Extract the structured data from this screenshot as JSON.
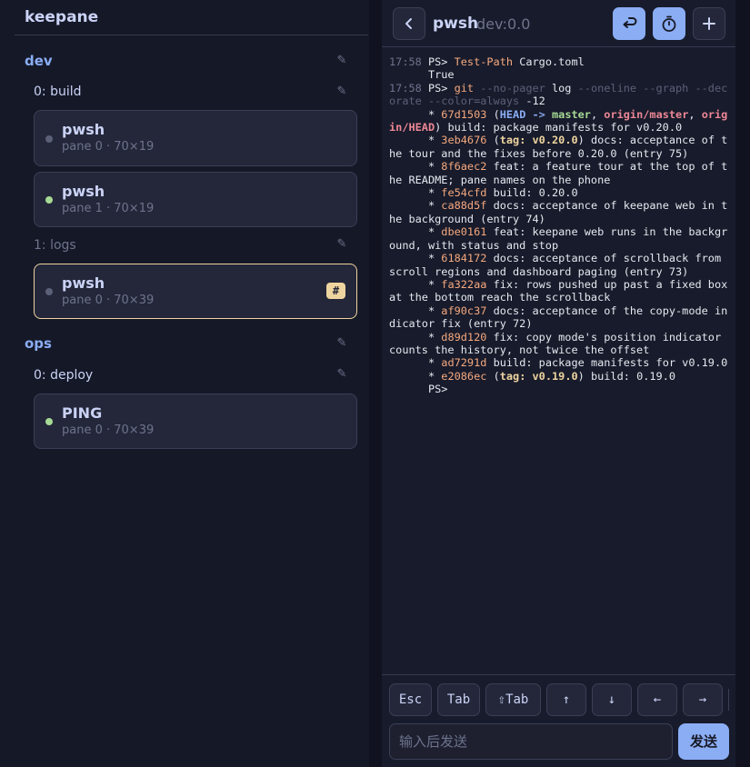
{
  "app": {
    "title": "keepane"
  },
  "sidebar": {
    "sessions": [
      {
        "name": "dev",
        "windows": [
          {
            "label": "0: build",
            "panes": [
              {
                "title": "pwsh",
                "meta": "pane 0 · 70×19",
                "status": "idle"
              },
              {
                "title": "pwsh",
                "meta": "pane 1 · 70×19",
                "status": "live"
              }
            ]
          },
          {
            "label": "1: logs",
            "panes": [
              {
                "title": "pwsh",
                "meta": "pane 0 · 70×39",
                "status": "idle",
                "badge": "#",
                "active": true
              }
            ]
          }
        ]
      },
      {
        "name": "ops",
        "windows": [
          {
            "label": "0: deploy",
            "panes": [
              {
                "title": "PING",
                "meta": "pane 0 · 70×39",
                "status": "live"
              }
            ]
          }
        ]
      }
    ]
  },
  "terminal": {
    "title": "pwsh",
    "target": "dev:0.0",
    "lines": [
      [
        [
          "17:58 ",
          "time"
        ],
        [
          "PS> ",
          ""
        ],
        [
          "Test-Path",
          "cmd"
        ],
        [
          " Cargo.toml",
          ""
        ]
      ],
      [
        [
          "      True",
          ""
        ]
      ],
      [
        [
          "17:58 ",
          "time"
        ],
        [
          "PS> ",
          ""
        ],
        [
          "git",
          "cmd"
        ],
        [
          " --no-pager",
          "flag"
        ],
        [
          " log",
          ""
        ],
        [
          " --oneline --graph --decorate --color=always",
          "flag"
        ],
        [
          " -12",
          ""
        ]
      ],
      [
        [
          "      * ",
          ""
        ],
        [
          "67d1503",
          "hash"
        ],
        [
          " (",
          ""
        ],
        [
          "HEAD -> ",
          "head"
        ],
        [
          "master",
          "branch"
        ],
        [
          ", ",
          ""
        ],
        [
          "origin/master",
          "remote"
        ],
        [
          ", ",
          ""
        ],
        [
          "origin/HEAD",
          "remote"
        ],
        [
          ") build: package manifests for v0.20.0",
          ""
        ]
      ],
      [
        [
          "      * ",
          ""
        ],
        [
          "3eb4676",
          "hash"
        ],
        [
          " (",
          ""
        ],
        [
          "tag: v0.20.0",
          "tag"
        ],
        [
          ") docs: acceptance of the tour and the fixes before 0.20.0 (entry 75)",
          ""
        ]
      ],
      [
        [
          "      * ",
          ""
        ],
        [
          "8f6aec2",
          "hash"
        ],
        [
          " feat: a feature tour at the top of the README; pane names on the phone",
          ""
        ]
      ],
      [
        [
          "      * ",
          ""
        ],
        [
          "fe54cfd",
          "hash"
        ],
        [
          " build: 0.20.0",
          ""
        ]
      ],
      [
        [
          "      * ",
          ""
        ],
        [
          "ca88d5f",
          "hash"
        ],
        [
          " docs: acceptance of keepane web in the background (entry 74)",
          ""
        ]
      ],
      [
        [
          "      * ",
          ""
        ],
        [
          "dbe0161",
          "hash"
        ],
        [
          " feat: keepane web runs in the background, with status and stop",
          ""
        ]
      ],
      [
        [
          "      * ",
          ""
        ],
        [
          "6184172",
          "hash"
        ],
        [
          " docs: acceptance of scrollback from scroll regions and dashboard paging (entry 73)",
          ""
        ]
      ],
      [
        [
          "      * ",
          ""
        ],
        [
          "fa322aa",
          "hash"
        ],
        [
          " fix: rows pushed up past a fixed box at the bottom reach the scrollback",
          ""
        ]
      ],
      [
        [
          "      * ",
          ""
        ],
        [
          "af90c37",
          "hash"
        ],
        [
          " docs: acceptance of the copy-mode indicator fix (entry 72)",
          ""
        ]
      ],
      [
        [
          "      * ",
          ""
        ],
        [
          "d89d120",
          "hash"
        ],
        [
          " fix: copy mode's position indicator counts the history, not twice the offset",
          ""
        ]
      ],
      [
        [
          "      * ",
          ""
        ],
        [
          "ad7291d",
          "hash"
        ],
        [
          " build: package manifests for v0.19.0",
          ""
        ]
      ],
      [
        [
          "      * ",
          ""
        ],
        [
          "e2086ec",
          "hash"
        ],
        [
          " (",
          ""
        ],
        [
          "tag: v0.19.0",
          "tag"
        ],
        [
          ") build: 0.19.0",
          ""
        ]
      ],
      [
        [
          "      PS>",
          ""
        ]
      ]
    ]
  },
  "keys": [
    "Esc",
    "Tab",
    "⇧Tab",
    "↑",
    "↓",
    "←",
    "→"
  ],
  "composer": {
    "placeholder": "输入后发送",
    "send_label": "发送"
  },
  "colors": {
    "accent": "#8aadf4",
    "live": "#a6da95",
    "active_border": "#eed49f"
  },
  "icons": {
    "back": "chevron-left-icon",
    "enter": "return-icon",
    "timer": "stopwatch-icon",
    "add": "plus-icon",
    "edit": "pencil-icon"
  }
}
